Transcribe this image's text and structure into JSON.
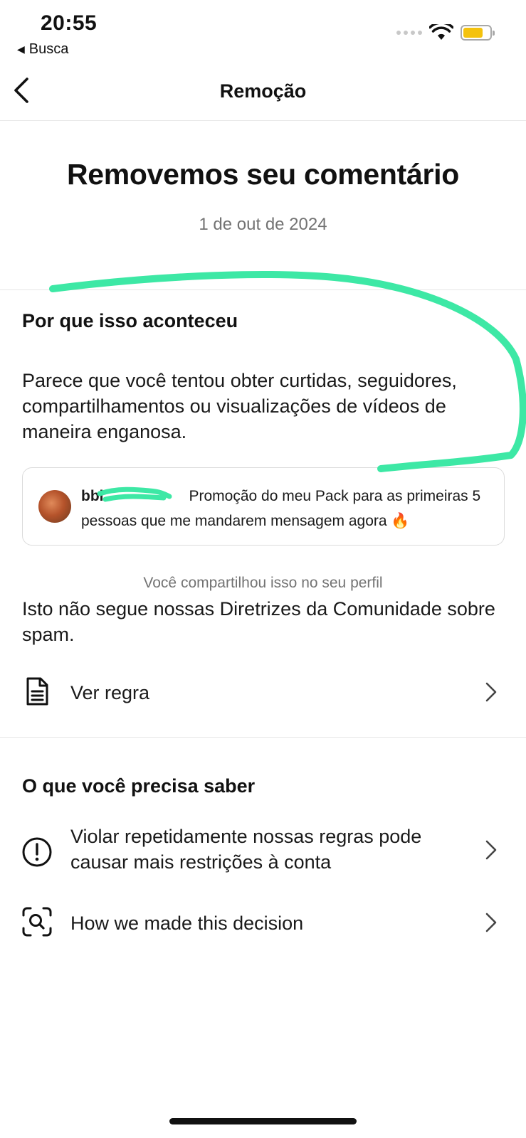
{
  "status_bar": {
    "time": "20:55",
    "back_app_label": "Busca"
  },
  "nav": {
    "title": "Remoção"
  },
  "headline": "Removemos seu comentário",
  "date": "1 de out de 2024",
  "why": {
    "title": "Por que isso aconteceu",
    "body": "Parece que você tentou obter curtidas, seguidores, compartilhamentos ou visualizações de vídeos de maneira enganosa."
  },
  "comment_card": {
    "username": "bbi",
    "text": "Promoção do meu Pack para as primeiras 5 pessoas que me mandarem mensagem agora 🔥"
  },
  "shared_caption": "Você compartilhou isso no seu perfil",
  "guideline_text": "Isto não segue nossas Diretrizes da Comunidade sobre spam.",
  "see_rule": {
    "label": "Ver regra",
    "icon": "document-icon"
  },
  "need_to_know": {
    "title": "O que você precisa saber",
    "items": [
      {
        "label": "Violar repetidamente nossas regras pode causar mais restrições à conta",
        "icon": "alert-circle-icon"
      },
      {
        "label": "How we made this decision",
        "icon": "search-scan-icon"
      }
    ]
  },
  "colors": {
    "annotation_marker": "#3de8a5",
    "secondary_text": "#737373",
    "battery": "#f4c20d"
  }
}
